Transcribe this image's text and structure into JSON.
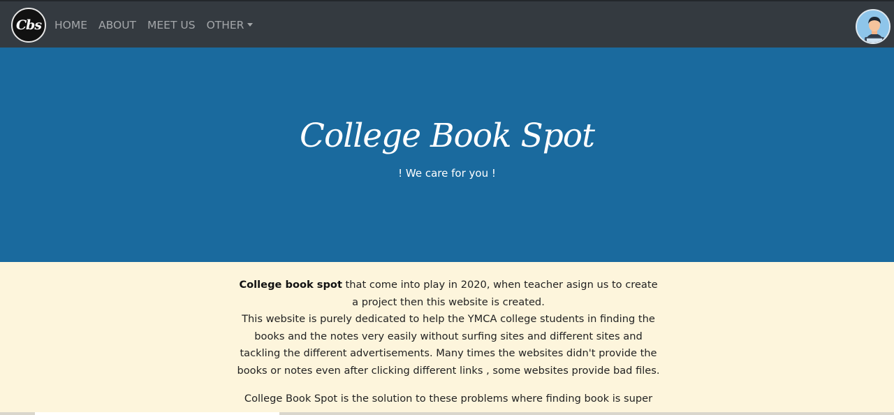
{
  "navbar": {
    "logo_text": "Cbs",
    "items": [
      {
        "label": "HOME"
      },
      {
        "label": "ABOUT"
      },
      {
        "label": "MEET US"
      },
      {
        "label": "OTHER"
      }
    ]
  },
  "hero": {
    "title": "College Book Spot",
    "subtitle": "! We care for you !"
  },
  "content": {
    "p1_bold": "College book spot",
    "p1_rest": " that come into play in 2020, when teacher asign us to create a project then this website is created.",
    "p1_line2": "This website is purely dedicated to help the YMCA college students in finding the books and the notes very easily without surfing sites and different sites and tackling the different advertisements. Many times the websites didn't provide the books or notes even after clicking different links , some websites provide bad files.",
    "p2": "College Book Spot is the solution to these problems where finding book is super"
  },
  "colors": {
    "navbar_bg": "#343a40",
    "hero_bg": "#1a6a9e",
    "content_bg": "#fdf5dc"
  }
}
